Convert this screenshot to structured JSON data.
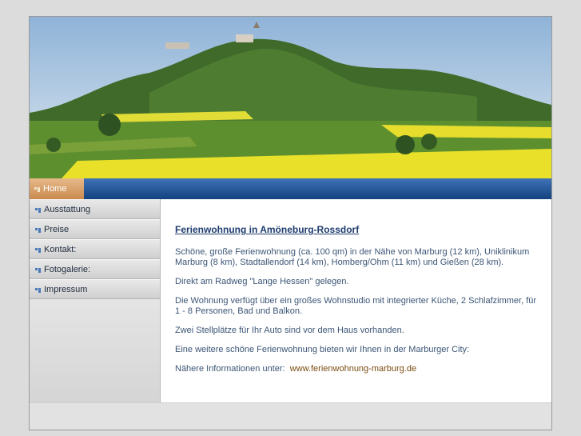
{
  "nav": {
    "home_label": "Home"
  },
  "sidebar": {
    "items": [
      {
        "label": "Ausstattung"
      },
      {
        "label": "Preise"
      },
      {
        "label": "Kontakt:"
      },
      {
        "label": "Fotogalerie:"
      },
      {
        "label": "Impressum"
      }
    ]
  },
  "main": {
    "heading": "Ferienwohnung in Amöneburg-Rossdorf",
    "paragraphs": [
      "Schöne, große Ferienwohnung (ca. 100 qm) in der Nähe von Marburg (12 km), Uniklinikum Marburg (8 km), Stadtallendorf (14 km), Homberg/Ohm (11 km) und Gießen (28 km).",
      "Direkt am Radweg \"Lange Hessen\" gelegen.",
      "Die Wohnung verfügt über ein großes Wohnstudio mit integrierter Küche, 2 Schlafzimmer, für 1 - 8 Personen, Bad und Balkon.",
      "Zwei Stellplätze für Ihr Auto sind vor dem Haus  vorhanden.",
      "Eine weitere schöne Ferienwohnung bieten wir Ihnen in der Marburger City:"
    ],
    "more_info_prefix": "Nähere Informationen unter:",
    "more_info_link": "www.ferienwohnung-marburg.de"
  },
  "colors": {
    "nav_blue": "#1f4f8f",
    "home_tab": "#d9a06a",
    "heading": "#1e3c6e",
    "link": "#7b4b10"
  }
}
